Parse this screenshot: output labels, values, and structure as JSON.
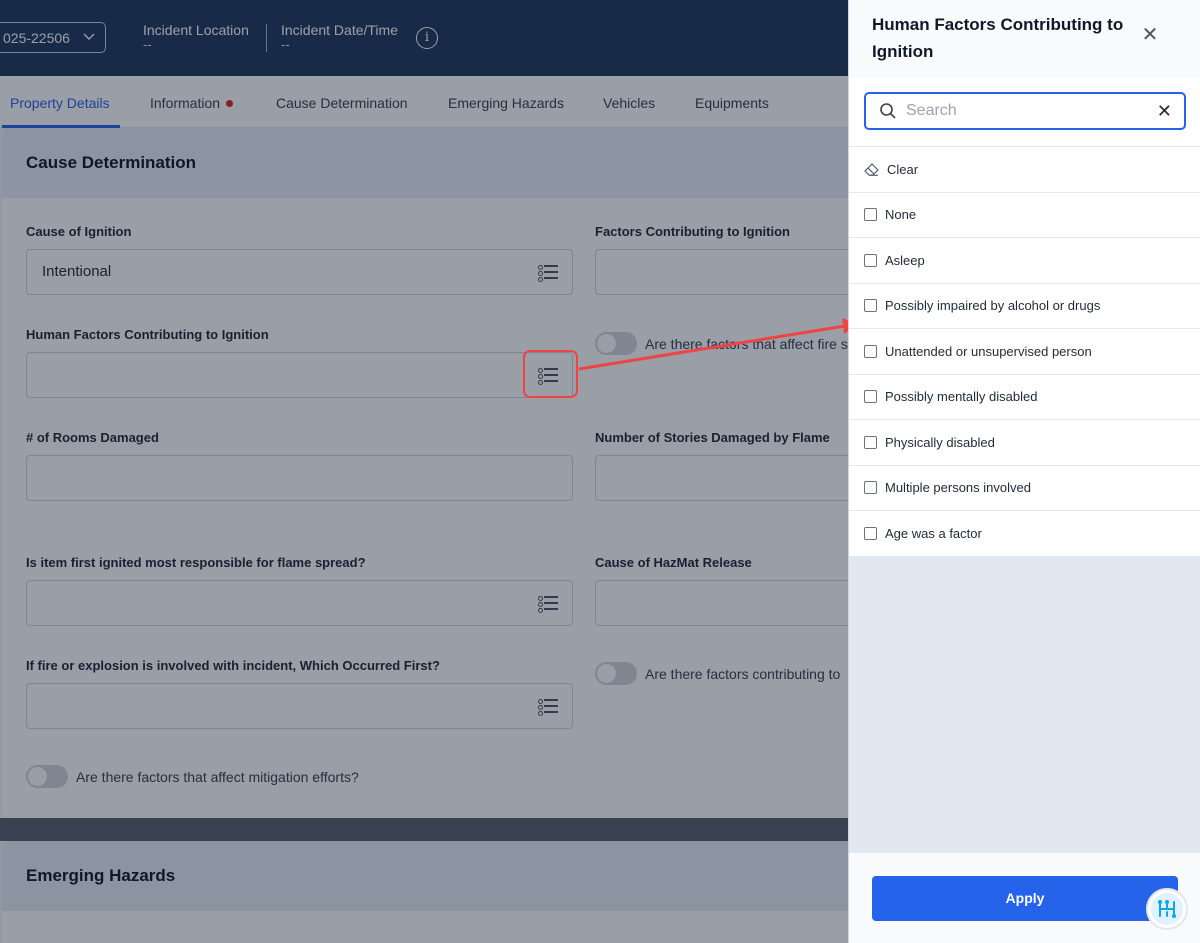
{
  "header": {
    "report_number": "025-22506",
    "location_label": "Incident Location",
    "location_value": "--",
    "datetime_label": "Incident Date/Time",
    "datetime_value": "--"
  },
  "tabs": [
    {
      "label": "Property Details",
      "active": true
    },
    {
      "label": "Information",
      "has_alert": true
    },
    {
      "label": "Cause Determination"
    },
    {
      "label": "Emerging Hazards"
    },
    {
      "label": "Vehicles"
    },
    {
      "label": "Equipments"
    }
  ],
  "cause_section": {
    "title": "Cause Determination",
    "fields": {
      "cause_of_ignition": {
        "label": "Cause of Ignition",
        "value": "Intentional"
      },
      "factors_contributing": {
        "label": "Factors Contributing to Ignition",
        "value": ""
      },
      "human_factors": {
        "label": "Human Factors Contributing to Ignition",
        "value": ""
      },
      "rooms_damaged": {
        "label": "# of Rooms Damaged",
        "value": ""
      },
      "stories_damaged": {
        "label": "Number of Stories Damaged by Flame",
        "value": ""
      },
      "item_first_ignited": {
        "label": "Is item first ignited most responsible for flame spread?",
        "value": ""
      },
      "hazmat_release": {
        "label": "Cause of HazMat Release",
        "value": ""
      },
      "fire_or_explosion": {
        "label": "If fire or explosion is involved with incident, Which Occurred First?",
        "value": ""
      }
    },
    "toggles": {
      "fire_spread": {
        "label": "Are there factors that affect fire s",
        "on": false
      },
      "contributing": {
        "label": "Are there factors contributing to",
        "on": false
      },
      "mitigation": {
        "label": "Are there factors that affect mitigation efforts?",
        "on": false
      }
    }
  },
  "hazards_section": {
    "title": "Emerging Hazards"
  },
  "panel": {
    "title": "Human Factors Contributing to Ignition",
    "search_placeholder": "Search",
    "clear_label": "Clear",
    "options": [
      {
        "label": "None",
        "checked": false
      },
      {
        "label": "Asleep",
        "checked": false
      },
      {
        "label": "Possibly impaired by alcohol or drugs",
        "checked": false
      },
      {
        "label": "Unattended or unsupervised person",
        "checked": false
      },
      {
        "label": "Possibly mentally disabled",
        "checked": false
      },
      {
        "label": "Physically disabled",
        "checked": false
      },
      {
        "label": "Multiple persons involved",
        "checked": false
      },
      {
        "label": "Age was a factor",
        "checked": false
      }
    ],
    "apply_label": "Apply"
  },
  "colors": {
    "topbar": "#1e3a5f",
    "accent": "#2563eb",
    "alert": "#dc2626",
    "annotation": "#ef4444"
  }
}
